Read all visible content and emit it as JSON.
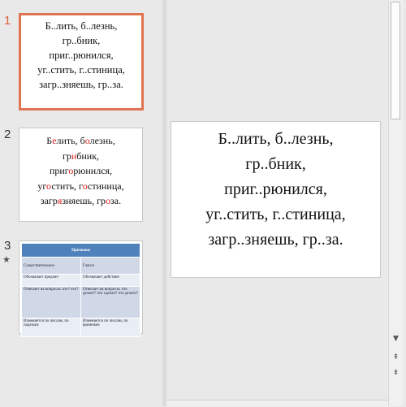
{
  "thumbnails": [
    {
      "number": "1",
      "lines": [
        "Б..лить, б..лезнь,",
        "гр..бник,",
        "приг..рюнился,",
        "уг..стить, г..стиница,",
        "загр..зняешь, гр..за."
      ]
    },
    {
      "number": "2",
      "lines": [
        [
          [
            "Б",
            ""
          ],
          [
            "е",
            "red"
          ],
          [
            "лить, б",
            ""
          ],
          [
            "о",
            "red"
          ],
          [
            "лезнь,",
            ""
          ]
        ],
        [
          [
            "гр",
            ""
          ],
          [
            "и",
            "red"
          ],
          [
            "бник,",
            ""
          ]
        ],
        [
          [
            "приг",
            ""
          ],
          [
            "о",
            "red"
          ],
          [
            "рюнился,",
            ""
          ]
        ],
        [
          [
            "уг",
            ""
          ],
          [
            "о",
            "red"
          ],
          [
            "стить, г",
            ""
          ],
          [
            "о",
            "red"
          ],
          [
            "стиница,",
            ""
          ]
        ],
        [
          [
            "загр",
            ""
          ],
          [
            "я",
            "red"
          ],
          [
            "зняешь, гр",
            ""
          ],
          [
            "о",
            "red"
          ],
          [
            "за.",
            ""
          ]
        ]
      ]
    },
    {
      "number": "3",
      "table": {
        "header": "Признаки",
        "rows": [
          [
            "Существительное",
            "Глагол"
          ],
          [
            "Обозначает предмет",
            "Обозначает действие"
          ],
          [
            "Отвечает на вопросы: кто? что?",
            "Отвечает на вопросы: что делает? что сделал? что делать?"
          ],
          [
            "Изменяется по числам, по падежам",
            "Изменяется по числам, по временам"
          ]
        ]
      }
    }
  ],
  "slide": {
    "lines": [
      "Б..лить, б..лезнь,",
      "гр..бник,",
      "приг..рюнился,",
      "уг..стить, г..стиница,",
      "загр..зняешь, гр..за."
    ]
  },
  "scrollbar": {
    "up": "▲",
    "down": "▼",
    "prev_slide": "⇞",
    "next_slide": "⇟"
  },
  "icons": {
    "star": "★"
  },
  "colors": {
    "selection": "#e0734f",
    "highlight": "#e02020",
    "table_header": "#4f81bd"
  }
}
